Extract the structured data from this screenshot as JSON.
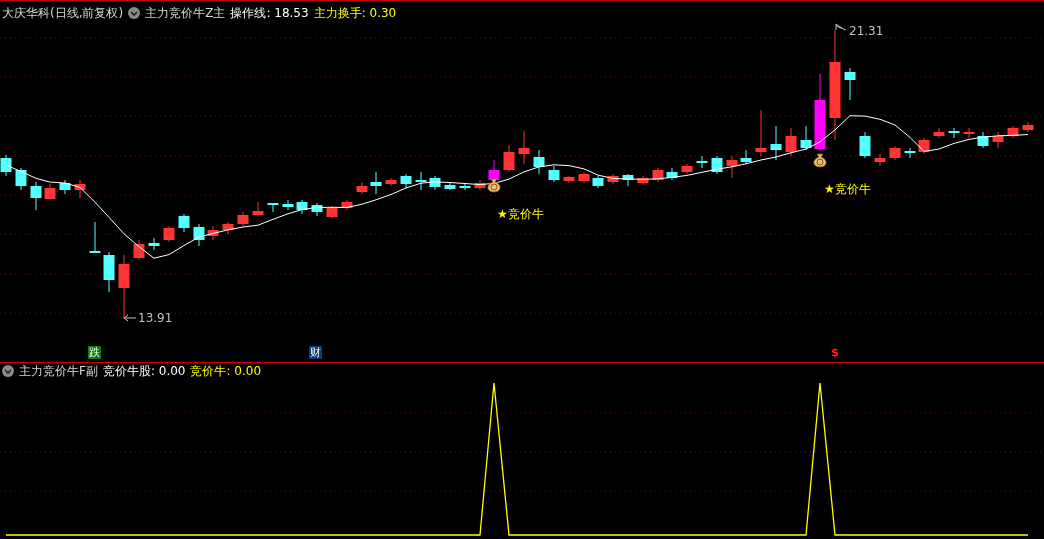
{
  "main_panel": {
    "title": "大庆华科(日线,前复权)",
    "indicator": "主力竞价牛Z主",
    "values": [
      {
        "text": "操作线: 18.53",
        "color": "#ffffff"
      },
      {
        "text": "主力换手: 0.30",
        "color": "#ffff00"
      }
    ],
    "high_label": "21.31",
    "low_label": "13.91",
    "signals": [
      {
        "text": "★竞价牛"
      },
      {
        "text": "★竞价牛"
      }
    ],
    "event_markers": [
      {
        "text": "跌",
        "color": "#0a7a0a"
      },
      {
        "text": "财",
        "color": "#0b3c78"
      },
      {
        "text": "$",
        "color": "#ff2020"
      }
    ]
  },
  "sub_panel": {
    "indicator": "主力竞价牛F副",
    "values": [
      {
        "text": "竞价牛股: 0.00",
        "color": "#ffffff"
      },
      {
        "text": "竞价牛: 0.00",
        "color": "#ffff00"
      }
    ]
  }
}
